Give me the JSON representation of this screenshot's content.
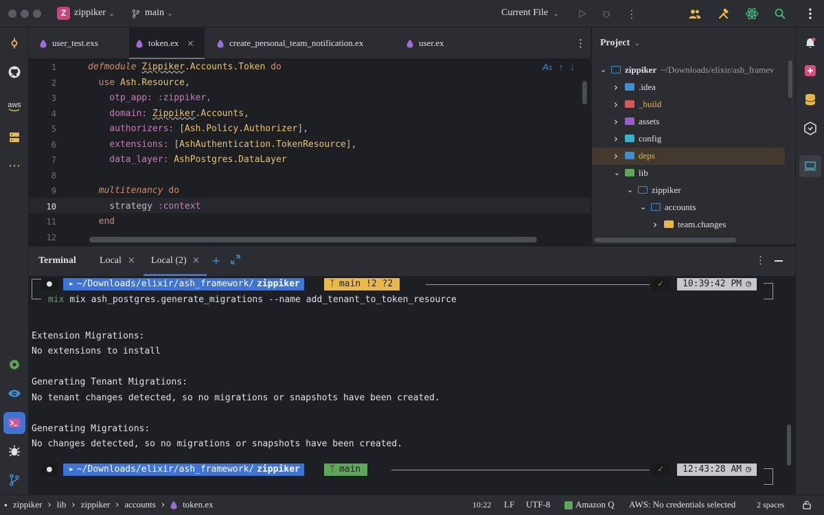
{
  "titlebar": {
    "project_badge": "Z",
    "project_name": "zippiker",
    "branch": "main",
    "run_config": "Current File",
    "icons": [
      "people-icon",
      "hammer-icon",
      "atom-icon",
      "search-icon",
      "more-icon"
    ]
  },
  "tabs": [
    {
      "label": "user_test.exs"
    },
    {
      "label": "token.ex"
    },
    {
      "label": "create_personal_team_notification.ex"
    },
    {
      "label": "user.ex"
    }
  ],
  "editor": {
    "problems": "3",
    "line_numbers": [
      "1",
      "2",
      "3",
      "4",
      "5",
      "6",
      "7",
      "8",
      "9",
      "10",
      "11",
      "12"
    ],
    "lines": [
      [
        {
          "t": "defmodule ",
          "c": "kwi"
        },
        {
          "t": "Zippiker",
          "c": "mod"
        },
        {
          "t": ".Accounts.Token ",
          "c": "mod"
        },
        {
          "t": "do",
          "c": "kw"
        }
      ],
      [
        {
          "t": "  use ",
          "c": "kw"
        },
        {
          "t": "Ash.Resource",
          "c": "mod"
        },
        {
          "t": ",",
          "c": "plain"
        }
      ],
      [
        {
          "t": "    otp_app: :zippiker,",
          "c": "atom"
        }
      ],
      [
        {
          "t": "    domain: ",
          "c": "atom"
        },
        {
          "t": "Zippiker",
          "c": "mod"
        },
        {
          "t": ".Accounts",
          "c": "mod"
        },
        {
          "t": ",",
          "c": "plain"
        }
      ],
      [
        {
          "t": "    authorizers: ",
          "c": "atom"
        },
        {
          "t": "[",
          "c": "plain"
        },
        {
          "t": "Ash.Policy.Authorizer",
          "c": "mod"
        },
        {
          "t": "],",
          "c": "plain"
        }
      ],
      [
        {
          "t": "    extensions: ",
          "c": "atom"
        },
        {
          "t": "[",
          "c": "plain"
        },
        {
          "t": "AshAuthentication.TokenResource",
          "c": "mod"
        },
        {
          "t": "],",
          "c": "plain"
        }
      ],
      [
        {
          "t": "    data_layer: ",
          "c": "atom"
        },
        {
          "t": "AshPostgres.DataLayer",
          "c": "mod"
        }
      ],
      [],
      [
        {
          "t": "  multitenancy ",
          "c": "kwi"
        },
        {
          "t": "do",
          "c": "kw"
        }
      ],
      [
        {
          "t": "    strategy ",
          "c": "plain"
        },
        {
          "t": ":context",
          "c": "atom"
        }
      ],
      [
        {
          "t": "  end",
          "c": "kw"
        }
      ],
      []
    ]
  },
  "project": {
    "title": "Project",
    "root_name": "zippiker",
    "root_path": "~/Downloads/elixir/ash_framev",
    "items": [
      {
        "label": ".idea",
        "color": "#3d8fd1"
      },
      {
        "label": "_build",
        "color": "#d45a5a"
      },
      {
        "label": "assets",
        "color": "#9c5dcb"
      },
      {
        "label": "config",
        "color": "#3db3c9"
      },
      {
        "label": "deps",
        "color": "#3d8fd1"
      },
      {
        "label": "lib",
        "color": "#5fa55a"
      },
      {
        "label": "zippiker",
        "color": "#2b2d30"
      },
      {
        "label": "accounts",
        "color": "#2b2d30"
      },
      {
        "label": "team.changes",
        "color": "#e8b84b"
      }
    ]
  },
  "terminal": {
    "title": "Terminal",
    "tabs": [
      {
        "label": "Local"
      },
      {
        "label": "Local (2)"
      }
    ],
    "prompt1": {
      "path": "~/Downloads/elixir/ash_framework/",
      "dir": "zippiker",
      "branch": "main !2 ?2",
      "time": "10:39:42 PM"
    },
    "command": "mix ash_postgres.generate_migrations --name add_tenant_to_token_resource",
    "output": [
      "",
      "Extension Migrations:",
      "No extensions to install",
      "",
      "Generating Tenant Migrations:",
      "No tenant changes detected, so no migrations or snapshots have been created.",
      "",
      "Generating Migrations:",
      "No changes detected, so no migrations or snapshots have been created."
    ],
    "prompt2": {
      "path": "~/Downloads/elixir/ash_framework/",
      "dir": "zippiker",
      "branch": "main",
      "time": "12:43:28 AM"
    }
  },
  "status": {
    "breadcrumb": [
      "zippiker",
      "lib",
      "zippiker",
      "accounts",
      "token.ex"
    ],
    "position": "10:22",
    "line_sep": "LF",
    "encoding": "UTF-8",
    "amazon_q": "Amazon Q",
    "aws": "AWS: No credentials selected",
    "indent": "2 spaces"
  },
  "sidebar_left": {
    "aws_label": "aws"
  }
}
